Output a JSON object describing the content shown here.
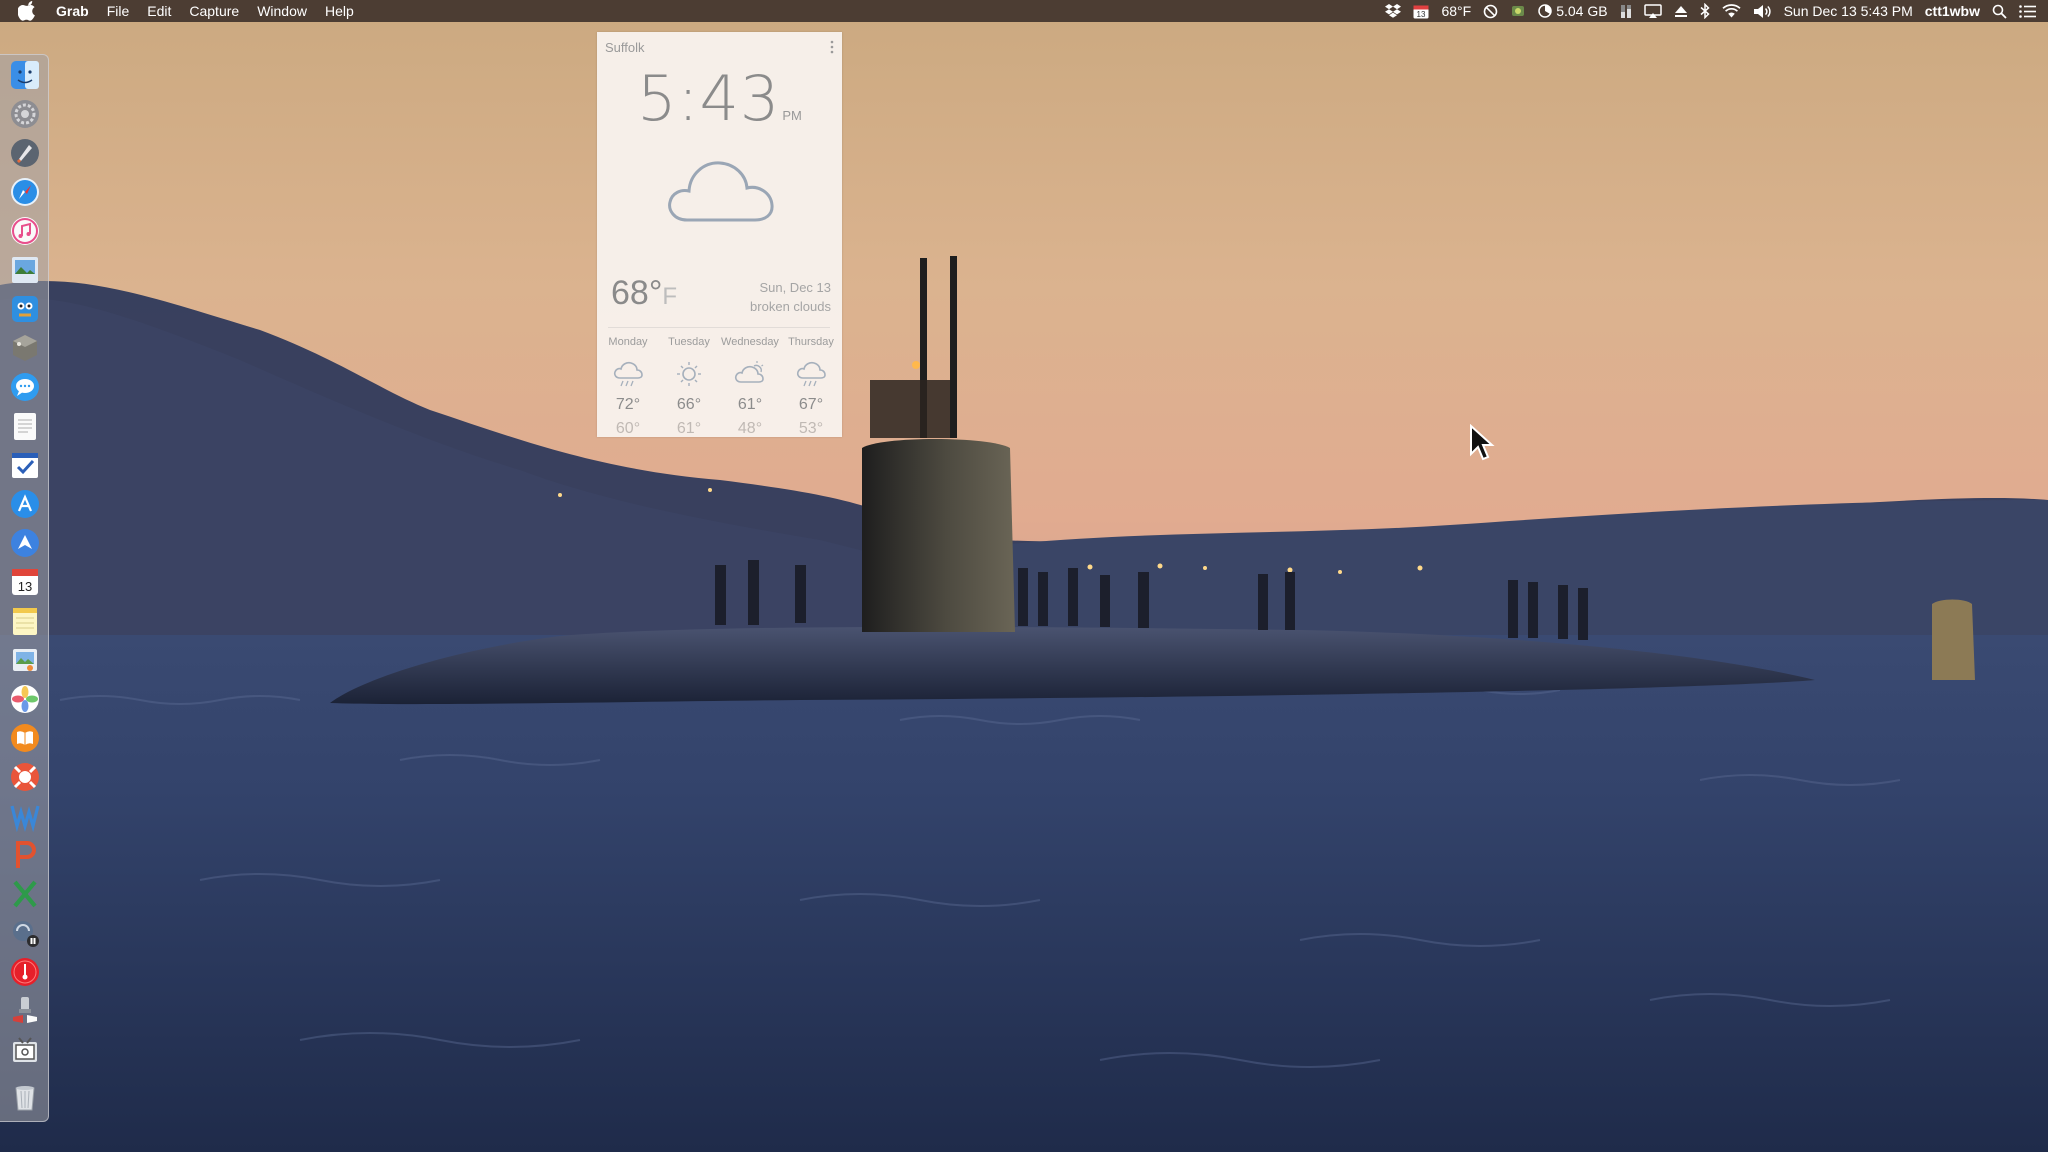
{
  "menubar": {
    "app_name": "Grab",
    "menus": [
      "File",
      "Edit",
      "Capture",
      "Window",
      "Help"
    ],
    "status": {
      "calendar_day": "13",
      "temperature": "68°F",
      "memory": "5.04 GB",
      "datetime": "Sun Dec 13  5:43 PM",
      "username": "ctt1wbw"
    }
  },
  "widget": {
    "location": "Suffolk",
    "time": "5:43",
    "ampm": "PM",
    "current_temp": "68°",
    "unit": "F",
    "date": "Sun, Dec 13",
    "condition": "broken clouds",
    "forecast": [
      {
        "day": "Monday",
        "hi": "72°",
        "lo": "60°",
        "icon": "rain-cloud-icon"
      },
      {
        "day": "Tuesday",
        "hi": "66°",
        "lo": "61°",
        "icon": "sun-icon"
      },
      {
        "day": "Wednesday",
        "hi": "61°",
        "lo": "48°",
        "icon": "partly-cloudy-icon"
      },
      {
        "day": "Thursday",
        "hi": "67°",
        "lo": "53°",
        "icon": "rain-cloud-icon"
      }
    ]
  },
  "dock": {
    "calendar_date": "13",
    "apps": [
      "finder-icon",
      "system-preferences-icon",
      "launchpad-icon",
      "safari-icon",
      "itunes-icon",
      "preview-icon",
      "scanner-icon",
      "utility-icon",
      "messages-icon",
      "textedit-icon",
      "reminders-icon",
      "app-store-icon",
      "navigation-icon",
      "calendar-icon",
      "notes-icon",
      "photo-viewer-icon",
      "photos-icon",
      "ibooks-icon",
      "lifesaver-icon",
      "word-icon",
      "powerpoint-icon",
      "excel-icon",
      "screen-recorder-icon",
      "music-player-icon",
      "script-editor-icon",
      "grab-icon",
      "trash-icon"
    ]
  },
  "colors": {
    "menubar_bg": "#3a2e28",
    "widget_bg": "#f8f2ee",
    "sky_top": "#cfae85",
    "sky_bottom": "#dca68e",
    "water": "#2d3b60"
  }
}
